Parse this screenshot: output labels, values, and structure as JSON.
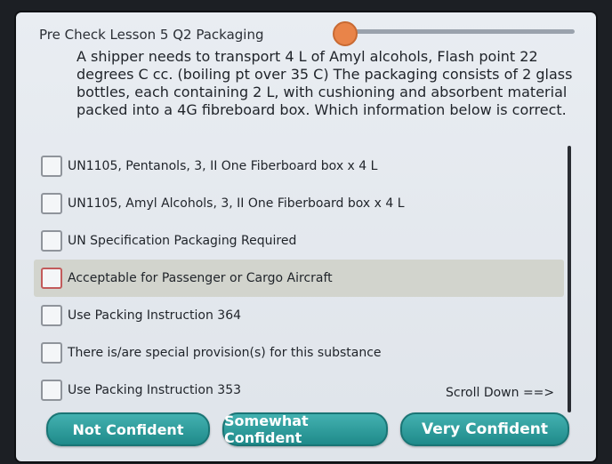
{
  "header": {
    "lesson_title": "Pre Check Lesson 5 Q2 Packaging"
  },
  "question": {
    "text": "A shipper needs to transport 4 L of Amyl alcohols, Flash point 22 degrees C cc. (boiling pt over 35 C) The packaging consists of 2 glass bottles, each containing 2 L, with cushioning and absorbent material packed into a 4G fibreboard box. Which information below is correct."
  },
  "options": [
    {
      "label": "UN1105, Pentanols, 3, II One Fiberboard box x 4 L"
    },
    {
      "label": "UN1105, Amyl Alcohols, 3, II One Fiberboard box x 4 L"
    },
    {
      "label": "UN Specification Packaging Required"
    },
    {
      "label": "Acceptable for Passenger or Cargo Aircraft"
    },
    {
      "label": "Use Packing Instruction 364"
    },
    {
      "label": "There is/are special provision(s) for this substance"
    },
    {
      "label": "Use Packing Instruction 353"
    }
  ],
  "scroll_hint": "Scroll Down ==>",
  "buttons": {
    "not_confident": "Not Confident",
    "somewhat_confident": "Somewhat Confident",
    "very_confident": "Very Confident"
  },
  "colors": {
    "accent": "#1f8a8a",
    "progress_knob": "#e98449"
  }
}
